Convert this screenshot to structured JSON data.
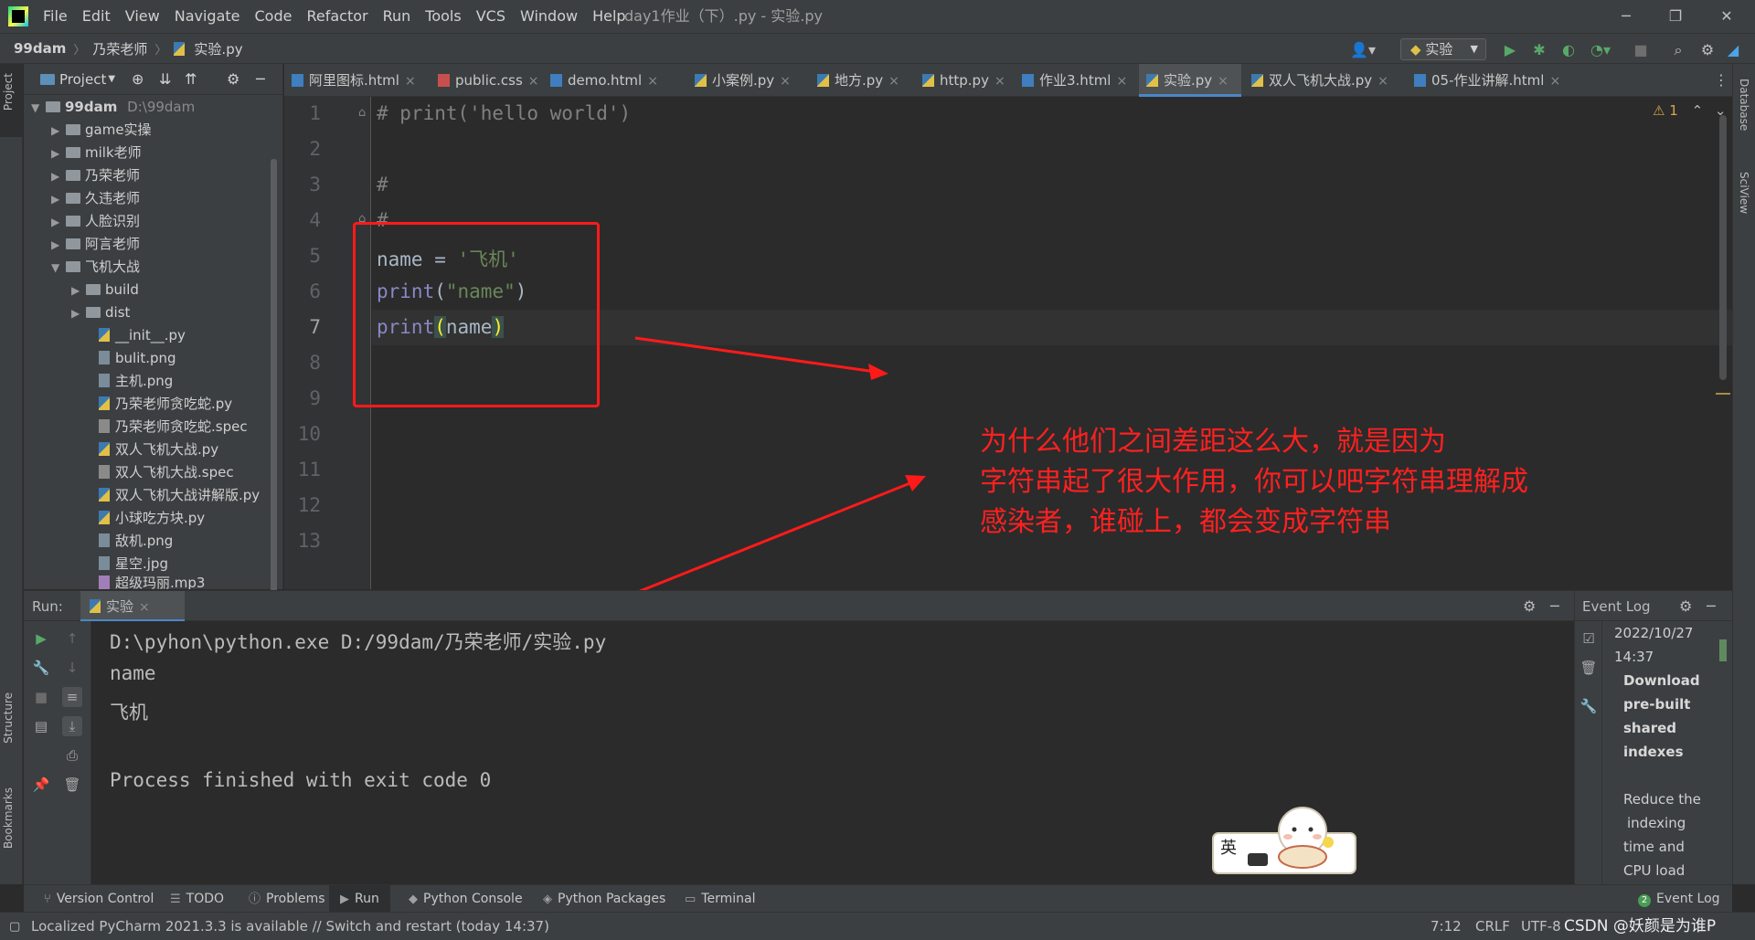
{
  "menu": {
    "items": [
      "File",
      "Edit",
      "View",
      "Navigate",
      "Code",
      "Refactor",
      "Run",
      "Tools",
      "VCS",
      "Window",
      "Help"
    ],
    "window_title": "day1作业（下）.py - 实验.py",
    "controls": [
      "─",
      "❐",
      "✕"
    ]
  },
  "breadcrumb": [
    "99dam",
    "乃荣老师",
    "实验.py"
  ],
  "toolbar": {
    "run_config": "实验"
  },
  "left_strip": {
    "project": "Project",
    "structure": "Structure",
    "bookmarks": "Bookmarks"
  },
  "right_strip": {
    "database": "Database",
    "sciview": "SciView"
  },
  "project": {
    "title": "Project",
    "root": {
      "name": "99dam",
      "path": "D:\\99dam"
    },
    "items": [
      "game实操",
      "milk老师",
      "乃荣老师",
      "久违老师",
      "人脸识别",
      "阿言老师",
      "飞机大战",
      "build",
      "dist",
      "__init__.py",
      "bulit.png",
      "主机.png",
      "乃荣老师贪吃蛇.py",
      "乃荣老师贪吃蛇.spec",
      "双人飞机大战.py",
      "双人飞机大战.spec",
      "双人飞机大战讲解版.py",
      "小球吃方块.py",
      "敌机.png",
      "星空.jpg",
      "超级玛丽.mp3"
    ]
  },
  "tabs": [
    "阿里图标.html",
    "public.css",
    "demo.html",
    "小案例.py",
    "地方.py",
    "http.py",
    "作业3.html",
    "实验.py",
    "双人飞机大战.py",
    "05-作业讲解.html"
  ],
  "editor": {
    "line_numbers": [
      "1",
      "2",
      "3",
      "4",
      "5",
      "6",
      "7",
      "8",
      "9",
      "10",
      "11",
      "12",
      "13"
    ],
    "line1": "# print('hello world')",
    "line3": "#",
    "line4": "#",
    "line5_var": "name = ",
    "line5_str": "'飞机'",
    "line6_fn": "print",
    "line6_open": "(",
    "line6_str": "\"name\"",
    "line6_close": ")",
    "line7_fn": "print",
    "line7_open": "(",
    "line7_arg": "name",
    "line7_close": ")",
    "warnings": "1"
  },
  "annotation": {
    "line1": "为什么他们之间差距这么大，就是因为",
    "line2": "字符串起了很大作用，你可以吧字符串理解成",
    "line3": "感染者，谁碰上，都会变成字符串"
  },
  "run": {
    "label": "Run:",
    "tab": "实验",
    "output": [
      "D:\\pyhon\\python.exe D:/99dam/乃荣老师/实验.py",
      "name",
      "飞机",
      "",
      "Process finished with exit code 0"
    ]
  },
  "event_log": {
    "title": "Event Log",
    "date": "2022/10/27",
    "time": "14:37",
    "bold_lines": [
      "Download",
      "pre-built",
      "shared",
      "indexes"
    ],
    "lines": [
      "Reduce the",
      "indexing",
      "time and",
      "CPU load"
    ]
  },
  "bottom_tools": [
    "Version Control",
    "TODO",
    "Problems",
    "Run",
    "Python Console",
    "Python Packages",
    "Terminal",
    "Event Log"
  ],
  "event_log_badge": "2",
  "status": {
    "message": "Localized PyCharm 2021.3.3 is available // Switch and restart (today 14:37)",
    "position": "7:12",
    "line_sep": "CRLF",
    "encoding": "UTF-8",
    "watermark": "CSDN @妖颜是为谁P"
  },
  "mascot": {
    "label": "英"
  },
  "colors": {
    "annotation_red": "#ff1a1a",
    "accent_blue": "#4a88c7",
    "string_green": "#6a8759",
    "builtin_purple": "#8888c6"
  }
}
